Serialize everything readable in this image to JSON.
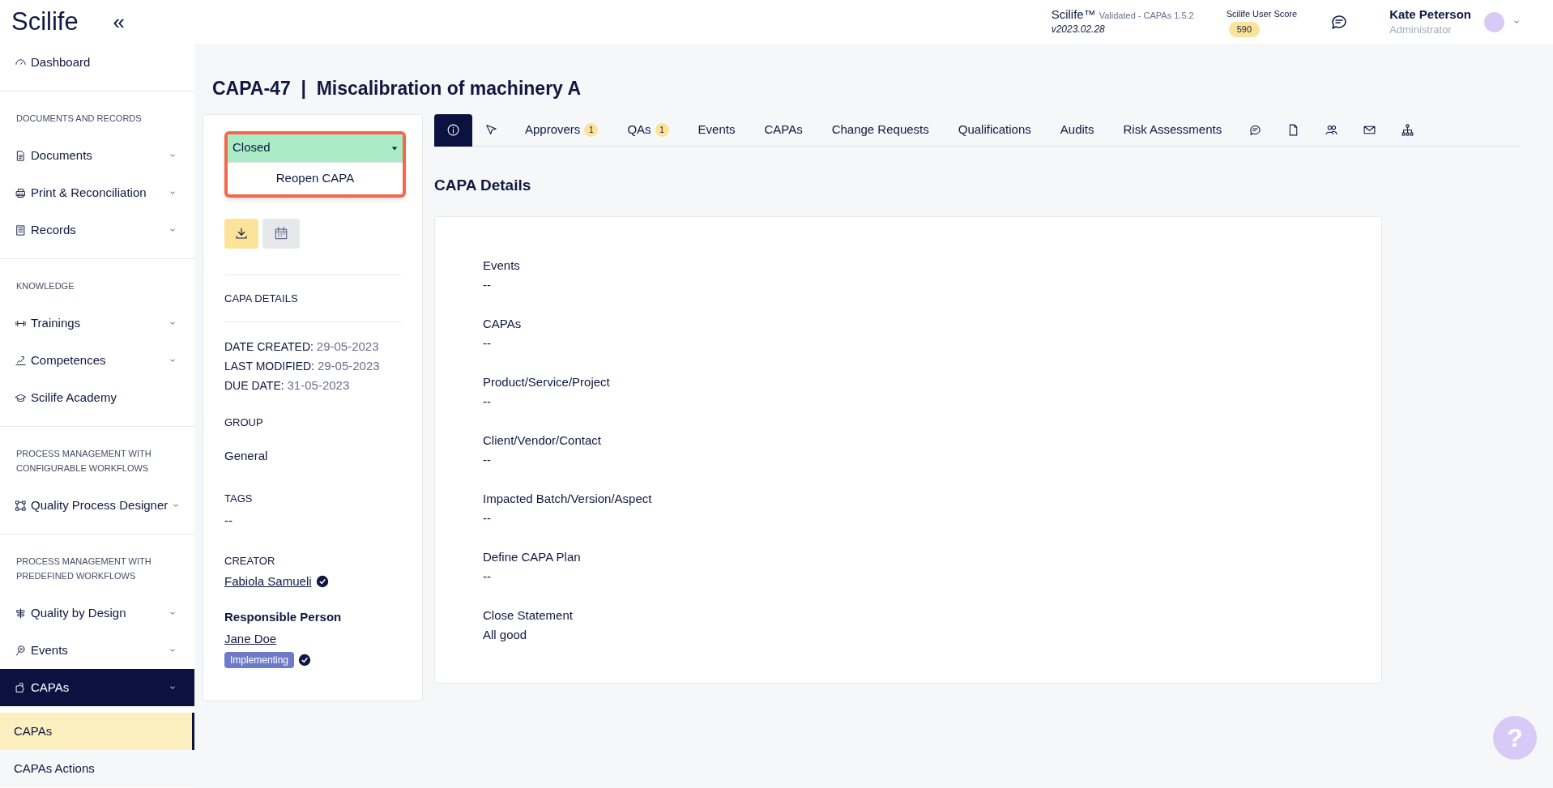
{
  "sidebar": {
    "logo": "Scilife",
    "collapse_icon": "«",
    "sections": [
      {
        "items": [
          {
            "label": "Dashboard",
            "has_caret": false,
            "selected": false
          }
        ]
      },
      {
        "header": "DOCUMENTS AND RECORDS",
        "items": [
          {
            "label": "Documents",
            "has_caret": true,
            "selected": false
          },
          {
            "label": "Print & Reconciliation",
            "has_caret": true,
            "selected": false
          },
          {
            "label": "Records",
            "has_caret": true,
            "selected": false
          }
        ]
      },
      {
        "header": "KNOWLEDGE",
        "items": [
          {
            "label": "Trainings",
            "has_caret": true,
            "selected": false
          },
          {
            "label": "Competences",
            "has_caret": true,
            "selected": false
          },
          {
            "label": "Scilife Academy",
            "has_caret": false,
            "selected": false
          }
        ]
      },
      {
        "header": "PROCESS MANAGEMENT WITH CONFIGURABLE WORKFLOWS",
        "items": [
          {
            "label": "Quality Process Designer",
            "has_caret": true,
            "selected": false
          }
        ]
      },
      {
        "header": "PROCESS MANAGEMENT WITH PREDEFINED WORKFLOWS",
        "items": [
          {
            "label": "Quality by Design",
            "has_caret": true,
            "selected": false
          },
          {
            "label": "Events",
            "has_caret": true,
            "selected": false
          },
          {
            "label": "CAPAs",
            "has_caret": true,
            "selected": true,
            "children": [
              {
                "label": "CAPAs",
                "selected": true
              },
              {
                "label": "CAPAs Actions",
                "selected": false
              }
            ]
          }
        ]
      }
    ]
  },
  "header": {
    "product": "Scilife™",
    "validated": "Validated - CAPAs 1.5.2",
    "version": "v2023.02.28",
    "score_label": "Scilife User Score",
    "score": "590",
    "user_name": "Kate Peterson",
    "user_role": "Administrator"
  },
  "page_title": "CAPA-47  |  Miscalibration of machinery A",
  "status_panel": {
    "status": "Closed",
    "menu_option": "Reopen CAPA",
    "section_title": "CAPA DETAILS",
    "dates": [
      {
        "label": "DATE CREATED:",
        "value": "29-05-2023"
      },
      {
        "label": "LAST MODIFIED:",
        "value": "29-05-2023"
      },
      {
        "label": "DUE DATE:",
        "value": "31-05-2023"
      }
    ],
    "group_label": "GROUP",
    "group": "General",
    "tags_label": "TAGS",
    "tags": "--",
    "creator_label": "CREATOR",
    "creator": "Fabiola Samueli",
    "responsible_label": "Responsible Person",
    "responsible": "Jane Doe",
    "responsible_status": "Implementing"
  },
  "tabs": [
    {
      "kind": "icon",
      "selected": true
    },
    {
      "kind": "icon",
      "selected": false
    },
    {
      "kind": "text",
      "label": "Approvers",
      "count": "1",
      "selected": false
    },
    {
      "kind": "text",
      "label": "QAs",
      "count": "1",
      "selected": false
    },
    {
      "kind": "text",
      "label": "Events",
      "selected": false
    },
    {
      "kind": "text",
      "label": "CAPAs",
      "selected": false
    },
    {
      "kind": "text",
      "label": "Change Requests",
      "selected": false
    },
    {
      "kind": "text",
      "label": "Qualifications",
      "selected": false
    },
    {
      "kind": "text",
      "label": "Audits",
      "selected": false
    },
    {
      "kind": "text",
      "label": "Risk Assessments",
      "selected": false
    },
    {
      "kind": "icon",
      "selected": false
    },
    {
      "kind": "icon",
      "selected": false
    },
    {
      "kind": "icon",
      "selected": false
    },
    {
      "kind": "icon",
      "selected": false
    },
    {
      "kind": "icon",
      "selected": false
    }
  ],
  "details_title": "CAPA Details",
  "details": [
    {
      "label": "Events",
      "value": "--"
    },
    {
      "label": "CAPAs",
      "value": "--"
    },
    {
      "label": "Product/Service/Project",
      "value": "--"
    },
    {
      "label": "Client/Vendor/Contact",
      "value": "--"
    },
    {
      "label": "Impacted Batch/Version/Aspect",
      "value": "--"
    },
    {
      "label": "Define CAPA Plan",
      "value": "--"
    },
    {
      "label": "Close Statement",
      "value": "All good"
    }
  ],
  "help_button": "?"
}
